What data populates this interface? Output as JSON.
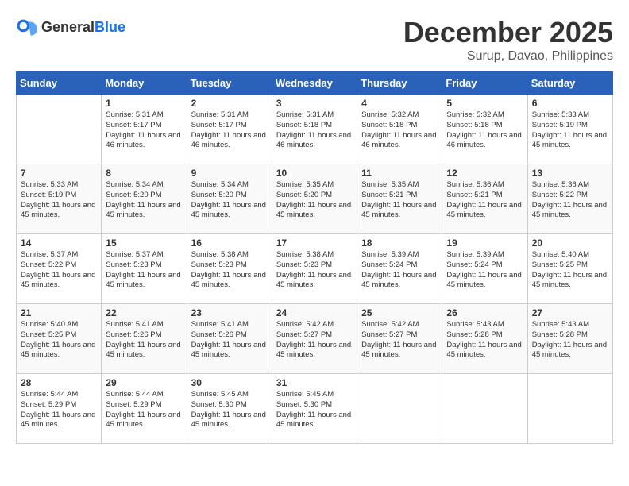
{
  "logo": {
    "general": "General",
    "blue": "Blue"
  },
  "title": {
    "month": "December 2025",
    "location": "Surup, Davao, Philippines"
  },
  "headers": [
    "Sunday",
    "Monday",
    "Tuesday",
    "Wednesday",
    "Thursday",
    "Friday",
    "Saturday"
  ],
  "weeks": [
    [
      {
        "day": "",
        "sunrise": "",
        "sunset": "",
        "daylight": ""
      },
      {
        "day": "1",
        "sunrise": "Sunrise: 5:31 AM",
        "sunset": "Sunset: 5:17 PM",
        "daylight": "Daylight: 11 hours and 46 minutes."
      },
      {
        "day": "2",
        "sunrise": "Sunrise: 5:31 AM",
        "sunset": "Sunset: 5:17 PM",
        "daylight": "Daylight: 11 hours and 46 minutes."
      },
      {
        "day": "3",
        "sunrise": "Sunrise: 5:31 AM",
        "sunset": "Sunset: 5:18 PM",
        "daylight": "Daylight: 11 hours and 46 minutes."
      },
      {
        "day": "4",
        "sunrise": "Sunrise: 5:32 AM",
        "sunset": "Sunset: 5:18 PM",
        "daylight": "Daylight: 11 hours and 46 minutes."
      },
      {
        "day": "5",
        "sunrise": "Sunrise: 5:32 AM",
        "sunset": "Sunset: 5:18 PM",
        "daylight": "Daylight: 11 hours and 46 minutes."
      },
      {
        "day": "6",
        "sunrise": "Sunrise: 5:33 AM",
        "sunset": "Sunset: 5:19 PM",
        "daylight": "Daylight: 11 hours and 45 minutes."
      }
    ],
    [
      {
        "day": "7",
        "sunrise": "Sunrise: 5:33 AM",
        "sunset": "Sunset: 5:19 PM",
        "daylight": "Daylight: 11 hours and 45 minutes."
      },
      {
        "day": "8",
        "sunrise": "Sunrise: 5:34 AM",
        "sunset": "Sunset: 5:20 PM",
        "daylight": "Daylight: 11 hours and 45 minutes."
      },
      {
        "day": "9",
        "sunrise": "Sunrise: 5:34 AM",
        "sunset": "Sunset: 5:20 PM",
        "daylight": "Daylight: 11 hours and 45 minutes."
      },
      {
        "day": "10",
        "sunrise": "Sunrise: 5:35 AM",
        "sunset": "Sunset: 5:20 PM",
        "daylight": "Daylight: 11 hours and 45 minutes."
      },
      {
        "day": "11",
        "sunrise": "Sunrise: 5:35 AM",
        "sunset": "Sunset: 5:21 PM",
        "daylight": "Daylight: 11 hours and 45 minutes."
      },
      {
        "day": "12",
        "sunrise": "Sunrise: 5:36 AM",
        "sunset": "Sunset: 5:21 PM",
        "daylight": "Daylight: 11 hours and 45 minutes."
      },
      {
        "day": "13",
        "sunrise": "Sunrise: 5:36 AM",
        "sunset": "Sunset: 5:22 PM",
        "daylight": "Daylight: 11 hours and 45 minutes."
      }
    ],
    [
      {
        "day": "14",
        "sunrise": "Sunrise: 5:37 AM",
        "sunset": "Sunset: 5:22 PM",
        "daylight": "Daylight: 11 hours and 45 minutes."
      },
      {
        "day": "15",
        "sunrise": "Sunrise: 5:37 AM",
        "sunset": "Sunset: 5:23 PM",
        "daylight": "Daylight: 11 hours and 45 minutes."
      },
      {
        "day": "16",
        "sunrise": "Sunrise: 5:38 AM",
        "sunset": "Sunset: 5:23 PM",
        "daylight": "Daylight: 11 hours and 45 minutes."
      },
      {
        "day": "17",
        "sunrise": "Sunrise: 5:38 AM",
        "sunset": "Sunset: 5:23 PM",
        "daylight": "Daylight: 11 hours and 45 minutes."
      },
      {
        "day": "18",
        "sunrise": "Sunrise: 5:39 AM",
        "sunset": "Sunset: 5:24 PM",
        "daylight": "Daylight: 11 hours and 45 minutes."
      },
      {
        "day": "19",
        "sunrise": "Sunrise: 5:39 AM",
        "sunset": "Sunset: 5:24 PM",
        "daylight": "Daylight: 11 hours and 45 minutes."
      },
      {
        "day": "20",
        "sunrise": "Sunrise: 5:40 AM",
        "sunset": "Sunset: 5:25 PM",
        "daylight": "Daylight: 11 hours and 45 minutes."
      }
    ],
    [
      {
        "day": "21",
        "sunrise": "Sunrise: 5:40 AM",
        "sunset": "Sunset: 5:25 PM",
        "daylight": "Daylight: 11 hours and 45 minutes."
      },
      {
        "day": "22",
        "sunrise": "Sunrise: 5:41 AM",
        "sunset": "Sunset: 5:26 PM",
        "daylight": "Daylight: 11 hours and 45 minutes."
      },
      {
        "day": "23",
        "sunrise": "Sunrise: 5:41 AM",
        "sunset": "Sunset: 5:26 PM",
        "daylight": "Daylight: 11 hours and 45 minutes."
      },
      {
        "day": "24",
        "sunrise": "Sunrise: 5:42 AM",
        "sunset": "Sunset: 5:27 PM",
        "daylight": "Daylight: 11 hours and 45 minutes."
      },
      {
        "day": "25",
        "sunrise": "Sunrise: 5:42 AM",
        "sunset": "Sunset: 5:27 PM",
        "daylight": "Daylight: 11 hours and 45 minutes."
      },
      {
        "day": "26",
        "sunrise": "Sunrise: 5:43 AM",
        "sunset": "Sunset: 5:28 PM",
        "daylight": "Daylight: 11 hours and 45 minutes."
      },
      {
        "day": "27",
        "sunrise": "Sunrise: 5:43 AM",
        "sunset": "Sunset: 5:28 PM",
        "daylight": "Daylight: 11 hours and 45 minutes."
      }
    ],
    [
      {
        "day": "28",
        "sunrise": "Sunrise: 5:44 AM",
        "sunset": "Sunset: 5:29 PM",
        "daylight": "Daylight: 11 hours and 45 minutes."
      },
      {
        "day": "29",
        "sunrise": "Sunrise: 5:44 AM",
        "sunset": "Sunset: 5:29 PM",
        "daylight": "Daylight: 11 hours and 45 minutes."
      },
      {
        "day": "30",
        "sunrise": "Sunrise: 5:45 AM",
        "sunset": "Sunset: 5:30 PM",
        "daylight": "Daylight: 11 hours and 45 minutes."
      },
      {
        "day": "31",
        "sunrise": "Sunrise: 5:45 AM",
        "sunset": "Sunset: 5:30 PM",
        "daylight": "Daylight: 11 hours and 45 minutes."
      },
      {
        "day": "",
        "sunrise": "",
        "sunset": "",
        "daylight": ""
      },
      {
        "day": "",
        "sunrise": "",
        "sunset": "",
        "daylight": ""
      },
      {
        "day": "",
        "sunrise": "",
        "sunset": "",
        "daylight": ""
      }
    ]
  ]
}
